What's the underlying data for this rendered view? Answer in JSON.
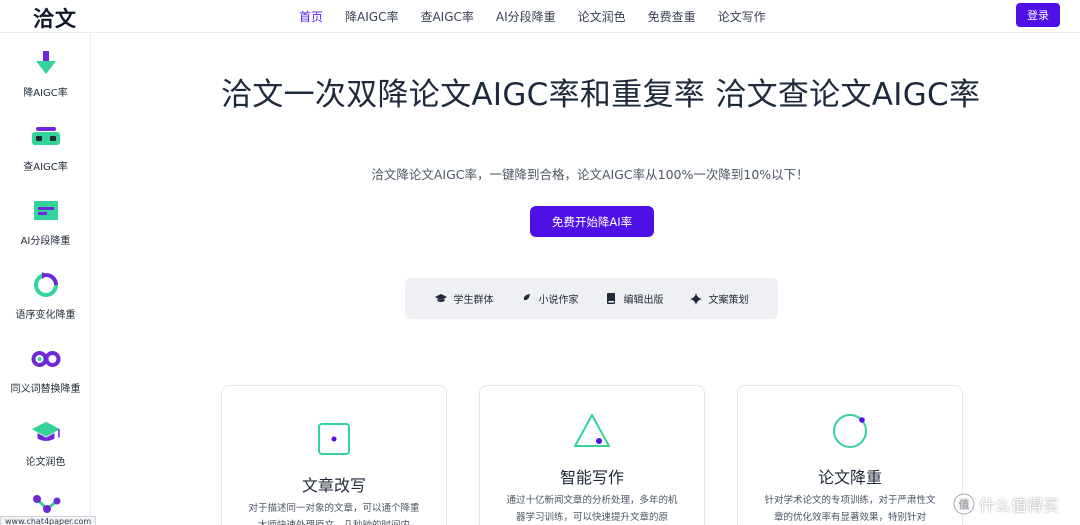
{
  "header": {
    "logo": "洽文",
    "nav": [
      {
        "label": "首页",
        "active": true
      },
      {
        "label": "降AIGC率"
      },
      {
        "label": "查AIGC率"
      },
      {
        "label": "AI分段降重"
      },
      {
        "label": "论文润色"
      },
      {
        "label": "免费查重"
      },
      {
        "label": "论文写作"
      }
    ],
    "login_label": "登录"
  },
  "sidebar": {
    "items": [
      {
        "label": "降AIGC率",
        "icon": "arrow-down-icon"
      },
      {
        "label": "查AIGC率",
        "icon": "vr-goggles-icon"
      },
      {
        "label": "AI分段降重",
        "icon": "text-block-icon"
      },
      {
        "label": "语序变化降重",
        "icon": "refresh-icon"
      },
      {
        "label": "同义词替换降重",
        "icon": "infinity-icon"
      },
      {
        "label": "论文润色",
        "icon": "graduation-cap-icon"
      },
      {
        "label": "",
        "icon": "network-icon"
      }
    ]
  },
  "hero": {
    "title": "洽文一次双降论文AIGC率和重复率 洽文查论文AIGC率",
    "subtitle": "洽文降论文AIGC率，一键降到合格，论文AIGC率从100%一次降到10%以下！",
    "cta_label": "免费开始降AI率"
  },
  "tags": [
    {
      "label": "学生群体",
      "icon": "graduation-cap-icon"
    },
    {
      "label": "小说作家",
      "icon": "feather-icon"
    },
    {
      "label": "编辑出版",
      "icon": "book-icon"
    },
    {
      "label": "文案策划",
      "icon": "sparkle-icon"
    }
  ],
  "cards": [
    {
      "title": "文章改写",
      "desc": "对于描述同一对象的文章，可以通个降重大师快速处理原文，几秒钟的时间内",
      "icon": "square-dot-icon"
    },
    {
      "title": "智能写作",
      "desc": "通过十亿新闻文章的分析处理，多年的机器学习训练，可以快速提升文章的原",
      "icon": "triangle-dot-icon"
    },
    {
      "title": "论文降重",
      "desc": "针对学术论文的专项训练，对于严肃性文章的优化效率有显著效果，特别针对",
      "icon": "circle-dot-icon"
    }
  ],
  "status_url": "www.chat4paper.com",
  "watermark": "什么值得买",
  "colors": {
    "accent": "#4f10e6",
    "icon_green": "#34d399",
    "icon_purple": "#6d28d9"
  }
}
